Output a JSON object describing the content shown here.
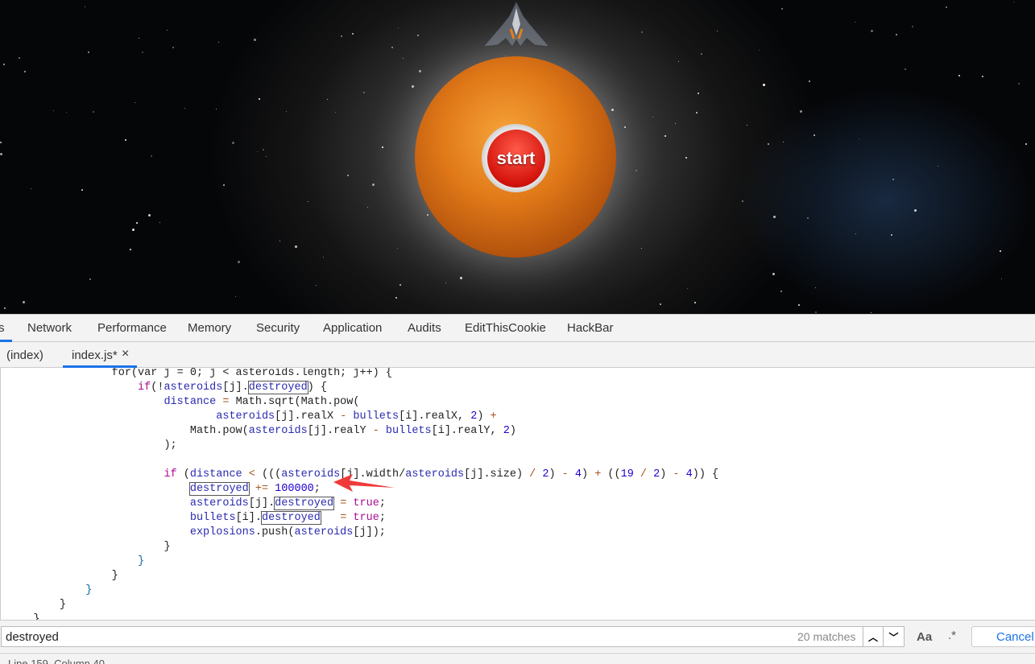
{
  "game": {
    "start_label": "start"
  },
  "devtools": {
    "tabs": [
      {
        "label": "s"
      },
      {
        "label": "Network"
      },
      {
        "label": "Performance"
      },
      {
        "label": "Memory"
      },
      {
        "label": "Security"
      },
      {
        "label": "Application"
      },
      {
        "label": "Audits"
      },
      {
        "label": "EditThisCookie"
      },
      {
        "label": "HackBar"
      }
    ],
    "files": [
      {
        "label": "(index)"
      },
      {
        "label": "index.js*"
      }
    ],
    "close_icon": "×",
    "accent": "#1a73e8",
    "code_lines": [
      [
        [
          16,
          "pl",
          "for(var j = 0; j < asteroids.length; j++) {"
        ]
      ],
      [
        [
          20,
          "kw",
          "if"
        ],
        [
          0,
          "pl",
          "(!"
        ],
        [
          0,
          "vr",
          "asteroids"
        ],
        [
          0,
          "pl",
          "[j]."
        ],
        [
          0,
          "hl",
          "destroyed"
        ],
        [
          0,
          "pl",
          ") {"
        ]
      ],
      [
        [
          24,
          "vr",
          "distance"
        ],
        [
          0,
          "op",
          " = "
        ],
        [
          0,
          "pl",
          "Math.sqrt(Math.pow("
        ]
      ],
      [
        [
          32,
          "vr",
          "asteroids"
        ],
        [
          0,
          "pl",
          "[j].realX "
        ],
        [
          0,
          "op",
          "-"
        ],
        [
          0,
          "vr",
          " bullets"
        ],
        [
          0,
          "pl",
          "[i].realX, "
        ],
        [
          0,
          "nm",
          "2"
        ],
        [
          0,
          "pl",
          ") "
        ],
        [
          0,
          "op",
          "+"
        ]
      ],
      [
        [
          28,
          "pl",
          "Math.pow("
        ],
        [
          0,
          "vr",
          "asteroids"
        ],
        [
          0,
          "pl",
          "[j].realY "
        ],
        [
          0,
          "op",
          "-"
        ],
        [
          0,
          "vr",
          " bullets"
        ],
        [
          0,
          "pl",
          "[i].realY, "
        ],
        [
          0,
          "nm",
          "2"
        ],
        [
          0,
          "pl",
          ")"
        ]
      ],
      [
        [
          24,
          "pl",
          ");"
        ]
      ],
      [],
      [
        [
          24,
          "kw",
          "if"
        ],
        [
          0,
          "pl",
          " ("
        ],
        [
          0,
          "vr",
          "distance"
        ],
        [
          0,
          "op",
          " < "
        ],
        [
          0,
          "pl",
          "((("
        ],
        [
          0,
          "vr",
          "asteroids"
        ],
        [
          0,
          "pl",
          "[j].width/"
        ],
        [
          0,
          "vr",
          "asteroids"
        ],
        [
          0,
          "pl",
          "[j].size) "
        ],
        [
          0,
          "op",
          "/"
        ],
        [
          0,
          "nm",
          " 2"
        ],
        [
          0,
          "pl",
          ") "
        ],
        [
          0,
          "op",
          "-"
        ],
        [
          0,
          "nm",
          " 4"
        ],
        [
          0,
          "pl",
          ") "
        ],
        [
          0,
          "op",
          "+"
        ],
        [
          0,
          "pl",
          " (("
        ],
        [
          0,
          "nm",
          "19"
        ],
        [
          0,
          "op",
          " / "
        ],
        [
          0,
          "nm",
          "2"
        ],
        [
          0,
          "pl",
          ") "
        ],
        [
          0,
          "op",
          "-"
        ],
        [
          0,
          "nm",
          " 4"
        ],
        [
          0,
          "pl",
          ")) {"
        ]
      ],
      [
        [
          28,
          "hl",
          "destroyed"
        ],
        [
          0,
          "op",
          " += "
        ],
        [
          0,
          "nm",
          "100000"
        ],
        [
          0,
          "pl",
          ";"
        ]
      ],
      [
        [
          28,
          "vr",
          "asteroids"
        ],
        [
          0,
          "pl",
          "[j]."
        ],
        [
          0,
          "hl",
          "destroyed"
        ],
        [
          0,
          "op",
          " = "
        ],
        [
          0,
          "kw",
          "true"
        ],
        [
          0,
          "pl",
          ";"
        ]
      ],
      [
        [
          28,
          "vr",
          "bullets"
        ],
        [
          0,
          "pl",
          "[i]."
        ],
        [
          0,
          "hl",
          "destroyed"
        ],
        [
          0,
          "op",
          "   = "
        ],
        [
          0,
          "kw",
          "true"
        ],
        [
          0,
          "pl",
          ";"
        ]
      ],
      [
        [
          28,
          "vr",
          "explosions"
        ],
        [
          0,
          "pl",
          ".push("
        ],
        [
          0,
          "vr",
          "asteroids"
        ],
        [
          0,
          "pl",
          "[j]);"
        ]
      ],
      [
        [
          24,
          "pl",
          "}"
        ]
      ],
      [
        [
          20,
          "br",
          "}"
        ]
      ],
      [
        [
          16,
          "pl",
          "}"
        ]
      ],
      [
        [
          12,
          "br",
          "}"
        ]
      ],
      [
        [
          8,
          "pl",
          "}"
        ]
      ],
      [
        [
          4,
          "pl",
          "}"
        ]
      ]
    ],
    "search": {
      "value": "destroyed",
      "matches": "20 matches",
      "case_label": "Aa",
      "regex_label": ".*",
      "cancel_label": "Cancel"
    },
    "status": "Line 159, Column 40"
  }
}
